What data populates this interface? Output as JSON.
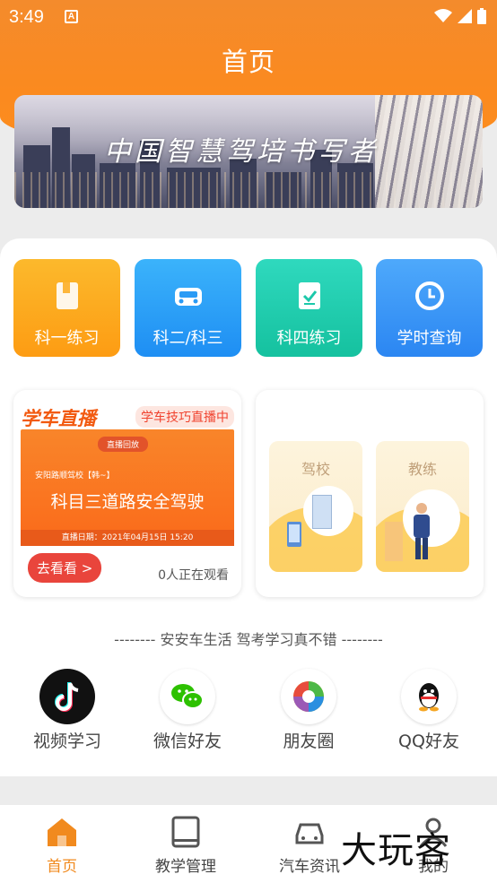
{
  "status_bar": {
    "time": "3:49",
    "notification": "A"
  },
  "header": {
    "title": "首页"
  },
  "banner": {
    "slogan": "中国智慧驾培书写者"
  },
  "tiles": [
    {
      "label": "科一练习",
      "icon": "book-icon",
      "color": "#fdac1f"
    },
    {
      "label": "科二/科三",
      "icon": "car-icon",
      "color": "#2aa0f7"
    },
    {
      "label": "科四练习",
      "icon": "checklist-icon",
      "color": "#1fcdb0"
    },
    {
      "label": "学时查询",
      "icon": "clock-icon",
      "color": "#3a97f6"
    }
  ],
  "live_card": {
    "tag": "学车直播",
    "badge": "学车技巧直播中",
    "poster_pill": "直播回放",
    "poster_school": "安阳路顺驾校【韩~】",
    "poster_subject": "科目三道路安全驾驶",
    "poster_date": "直播日期：2021年04月15日 15:20",
    "button": "去看看 >",
    "watchers": "0人正在观看"
  },
  "school_card": {
    "left_label": "驾校",
    "right_label": "教练"
  },
  "share": {
    "slogan": "--------  安安车生活  驾考学习真不错  --------",
    "items": [
      {
        "label": "视频学习",
        "icon": "tiktok-icon"
      },
      {
        "label": "微信好友",
        "icon": "wechat-icon"
      },
      {
        "label": "朋友圈",
        "icon": "moments-icon"
      },
      {
        "label": "QQ好友",
        "icon": "qq-icon"
      }
    ]
  },
  "tabbar": {
    "items": [
      {
        "label": "首页",
        "icon": "home-icon",
        "active": true
      },
      {
        "label": "教学管理",
        "icon": "notebook-icon"
      },
      {
        "label": "汽车资讯",
        "icon": "car-news-icon"
      },
      {
        "label": "我的",
        "icon": "profile-icon"
      }
    ]
  },
  "watermark": "大玩客",
  "colors": {
    "primary": "#f18a1e",
    "live_red": "#e9453c"
  }
}
